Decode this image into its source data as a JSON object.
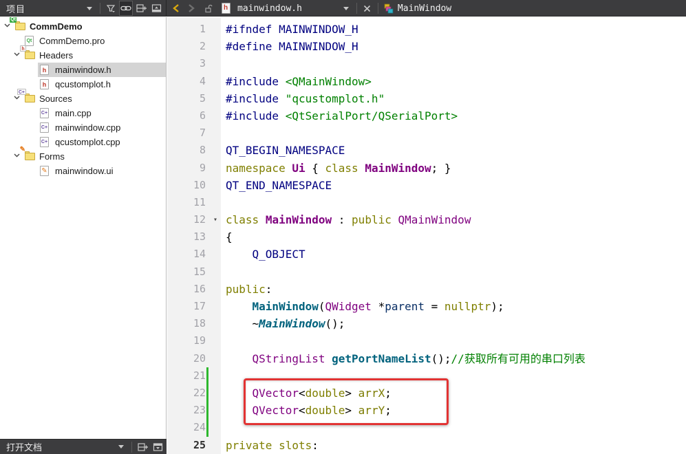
{
  "topbar": {
    "left_title": "项目",
    "file_tab": "mainwindow.h",
    "symbol_tab": "MainWindow",
    "icons": [
      "dropdown",
      "filter",
      "link",
      "split",
      "close-panel",
      "back",
      "forward",
      "lock",
      "header-file",
      "dropdown",
      "close",
      "class-symbol"
    ]
  },
  "sidebar": {
    "bottom_label": "打开文档",
    "bottom_icons": [
      "dropdown",
      "split",
      "close-panel"
    ],
    "tree": [
      {
        "label": "CommDemo",
        "level": 0,
        "icon": "qt-folder",
        "chevron": true,
        "bold": true,
        "selected": false
      },
      {
        "label": "CommDemo.pro",
        "level": 1,
        "icon": "qt-file",
        "chevron": false,
        "bold": false,
        "selected": false
      },
      {
        "label": "Headers",
        "level": 1,
        "icon": "h-folder",
        "chevron": true,
        "bold": false,
        "selected": false
      },
      {
        "label": "mainwindow.h",
        "level": 2,
        "icon": "h-file",
        "chevron": false,
        "bold": false,
        "selected": true
      },
      {
        "label": "qcustomplot.h",
        "level": 2,
        "icon": "h-file",
        "chevron": false,
        "bold": false,
        "selected": false
      },
      {
        "label": "Sources",
        "level": 1,
        "icon": "cpp-folder",
        "chevron": true,
        "bold": false,
        "selected": false
      },
      {
        "label": "main.cpp",
        "level": 2,
        "icon": "cpp-file",
        "chevron": false,
        "bold": false,
        "selected": false
      },
      {
        "label": "mainwindow.cpp",
        "level": 2,
        "icon": "cpp-file",
        "chevron": false,
        "bold": false,
        "selected": false
      },
      {
        "label": "qcustomplot.cpp",
        "level": 2,
        "icon": "cpp-file",
        "chevron": false,
        "bold": false,
        "selected": false
      },
      {
        "label": "Forms",
        "level": 1,
        "icon": "ui-folder",
        "chevron": true,
        "bold": false,
        "selected": false
      },
      {
        "label": "mainwindow.ui",
        "level": 2,
        "icon": "ui-file",
        "chevron": false,
        "bold": false,
        "selected": false
      }
    ]
  },
  "editor": {
    "token_colors": {
      "pp": "#000080",
      "str": "#008000",
      "cm": "#008000",
      "kw": "#7f7f00",
      "type": "#7f007f",
      "typeb": "#7f007f",
      "fnb": "#00627d",
      "fnbi": "#00627d",
      "param": "#092e64",
      "field": "#7b7b00",
      "pl": "#000000"
    },
    "lines": [
      {
        "n": 1,
        "tokens": [
          [
            "pp",
            "#ifndef MAINWINDOW_H"
          ]
        ]
      },
      {
        "n": 2,
        "tokens": [
          [
            "pp",
            "#define MAINWINDOW_H"
          ]
        ]
      },
      {
        "n": 3,
        "tokens": []
      },
      {
        "n": 4,
        "tokens": [
          [
            "pp",
            "#include "
          ],
          [
            "str",
            "<QMainWindow>"
          ]
        ]
      },
      {
        "n": 5,
        "tokens": [
          [
            "pp",
            "#include "
          ],
          [
            "str",
            "\"qcustomplot.h\""
          ]
        ]
      },
      {
        "n": 6,
        "tokens": [
          [
            "pp",
            "#include "
          ],
          [
            "str",
            "<QtSerialPort/QSerialPort>"
          ]
        ]
      },
      {
        "n": 7,
        "tokens": []
      },
      {
        "n": 8,
        "tokens": [
          [
            "pp",
            "QT_BEGIN_NAMESPACE"
          ]
        ]
      },
      {
        "n": 9,
        "tokens": [
          [
            "kw",
            "namespace"
          ],
          [
            "pl",
            " "
          ],
          [
            "typeb",
            "Ui"
          ],
          [
            "pl",
            " { "
          ],
          [
            "kw",
            "class"
          ],
          [
            "pl",
            " "
          ],
          [
            "typeb",
            "MainWindow"
          ],
          [
            "pl",
            "; }"
          ]
        ]
      },
      {
        "n": 10,
        "tokens": [
          [
            "pp",
            "QT_END_NAMESPACE"
          ]
        ]
      },
      {
        "n": 11,
        "tokens": []
      },
      {
        "n": 12,
        "tokens": [
          [
            "kw",
            "class"
          ],
          [
            "pl",
            " "
          ],
          [
            "typeb",
            "MainWindow"
          ],
          [
            "pl",
            " : "
          ],
          [
            "kw",
            "public"
          ],
          [
            "pl",
            " "
          ],
          [
            "type",
            "QMainWindow"
          ]
        ],
        "fold": true
      },
      {
        "n": 13,
        "tokens": [
          [
            "pl",
            "{"
          ]
        ]
      },
      {
        "n": 14,
        "tokens": [
          [
            "pp",
            "    Q_OBJECT"
          ]
        ]
      },
      {
        "n": 15,
        "tokens": []
      },
      {
        "n": 16,
        "tokens": [
          [
            "kw",
            "public"
          ],
          [
            "pl",
            ":"
          ]
        ]
      },
      {
        "n": 17,
        "tokens": [
          [
            "pl",
            "    "
          ],
          [
            "fnb",
            "MainWindow"
          ],
          [
            "pl",
            "("
          ],
          [
            "type",
            "QWidget"
          ],
          [
            "pl",
            " *"
          ],
          [
            "param",
            "parent"
          ],
          [
            "pl",
            " = "
          ],
          [
            "kw",
            "nullptr"
          ],
          [
            "pl",
            ");"
          ]
        ]
      },
      {
        "n": 18,
        "tokens": [
          [
            "pl",
            "    ~"
          ],
          [
            "fnbi",
            "MainWindow"
          ],
          [
            "pl",
            "();"
          ]
        ]
      },
      {
        "n": 19,
        "tokens": []
      },
      {
        "n": 20,
        "tokens": [
          [
            "pl",
            "    "
          ],
          [
            "type",
            "QStringList"
          ],
          [
            "pl",
            " "
          ],
          [
            "fnb",
            "getPortNameList"
          ],
          [
            "pl",
            "();"
          ],
          [
            "cm",
            "//获取所有可用的串口列表"
          ]
        ]
      },
      {
        "n": 21,
        "tokens": [],
        "changed": true
      },
      {
        "n": 22,
        "tokens": [
          [
            "pl",
            "    "
          ],
          [
            "type",
            "QVector"
          ],
          [
            "pl",
            "<"
          ],
          [
            "kw",
            "double"
          ],
          [
            "pl",
            "> "
          ],
          [
            "field",
            "arrX"
          ],
          [
            "pl",
            ";"
          ]
        ],
        "changed": true
      },
      {
        "n": 23,
        "tokens": [
          [
            "pl",
            "    "
          ],
          [
            "type",
            "QVector"
          ],
          [
            "pl",
            "<"
          ],
          [
            "kw",
            "double"
          ],
          [
            "pl",
            "> "
          ],
          [
            "field",
            "arrY"
          ],
          [
            "pl",
            ";"
          ]
        ],
        "changed": true
      },
      {
        "n": 24,
        "tokens": [],
        "changed": true
      },
      {
        "n": 25,
        "tokens": [
          [
            "kw",
            "private slots"
          ],
          [
            "pl",
            ":"
          ]
        ],
        "current": true
      }
    ]
  },
  "annotation": {
    "shape": "red-rectangle",
    "color": "#e23333",
    "marks_lines": [
      22,
      23
    ]
  },
  "colors": {
    "toolbar_bg": "#3c3c3e",
    "selection_bg": "#d4d4d4",
    "gutter_bg": "#f2f2f2",
    "change_bar": "#2db82d",
    "back_chevron": "#d7a80e"
  }
}
